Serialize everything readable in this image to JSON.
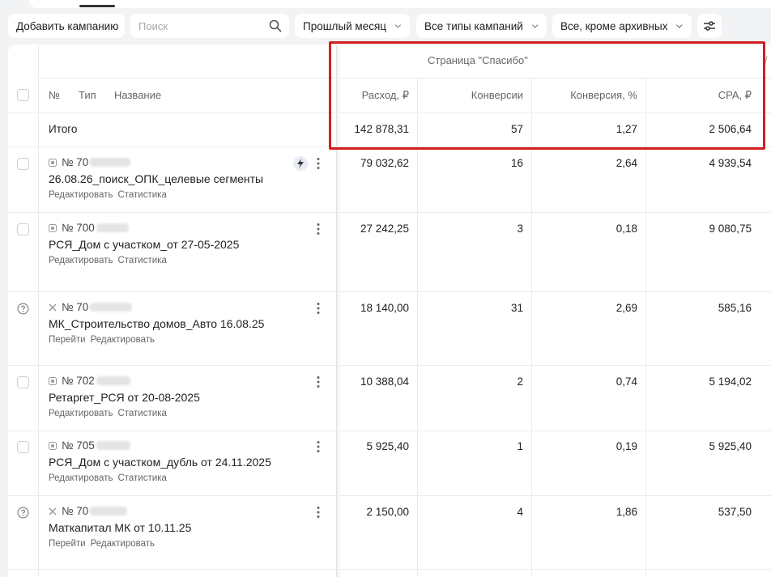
{
  "toolbar": {
    "add_campaign": "Добавить кампанию",
    "search_placeholder": "Поиск",
    "period": "Прошлый месяц",
    "types": "Все типы кампаний",
    "status": "Все, кроме архивных"
  },
  "table": {
    "group_header": "Страница \"Спасибо\"",
    "columns": {
      "num": "№",
      "type": "Тип",
      "name": "Название",
      "spend": "Расход, ₽",
      "conversions": "Конверсии",
      "conv_rate": "Конверсия, %",
      "cpa": "CPA, ₽"
    },
    "total": {
      "label": "Итого",
      "spend": "142 878,31",
      "conversions": "57",
      "conv_rate": "1,27",
      "cpa": "2 506,64"
    },
    "rows": [
      {
        "id": "№ 70",
        "name": "26.08.26_поиск_ОПК_целевые сегменты",
        "link1": "Редактировать",
        "link2": "Статистика",
        "spend": "79 032,62",
        "conversions": "16",
        "conv_rate": "2,64",
        "cpa": "4 939,54"
      },
      {
        "id": "№ 700",
        "name": "РСЯ_Дом с участком_от 27-05-2025",
        "link1": "Редактировать",
        "link2": "Статистика",
        "spend": "27 242,25",
        "conversions": "3",
        "conv_rate": "0,18",
        "cpa": "9 080,75"
      },
      {
        "id": "№ 70",
        "name": "МК_Строительство домов_Авто 16.08.25",
        "link1": "Перейти",
        "link2": "Редактировать",
        "spend": "18 140,00",
        "conversions": "31",
        "conv_rate": "2,69",
        "cpa": "585,16"
      },
      {
        "id": "№ 702",
        "name": "Ретаргет_РСЯ от 20-08-2025",
        "link1": "Редактировать",
        "link2": "Статистика",
        "spend": "10 388,04",
        "conversions": "2",
        "conv_rate": "0,74",
        "cpa": "5 194,02"
      },
      {
        "id": "№ 705",
        "name": "РСЯ_Дом с участком_дубль от 24.11.2025",
        "link1": "Редактировать",
        "link2": "Статистика",
        "spend": "5 925,40",
        "conversions": "1",
        "conv_rate": "0,19",
        "cpa": "5 925,40"
      },
      {
        "id": "№ 70",
        "name": "Маткапитал МК от 10.11.25",
        "link1": "Перейти",
        "link2": "Редактировать",
        "spend": "2 150,00",
        "conversions": "4",
        "conv_rate": "1,86",
        "cpa": "537,50"
      }
    ]
  },
  "colors": {
    "highlight": "#d21f1f",
    "accent": "#e8ecf5"
  }
}
